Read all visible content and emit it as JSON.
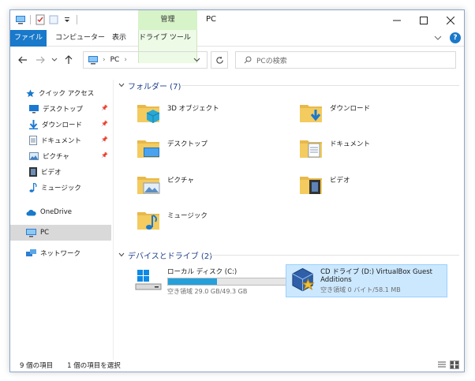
{
  "window": {
    "title": "PC",
    "context_tab": "管理"
  },
  "ribbon": {
    "tabs": [
      "ファイル",
      "コンピューター",
      "表示",
      "ドライブ ツール"
    ],
    "help": "?"
  },
  "nav": {
    "address_crumbs": [
      "PC"
    ],
    "search_placeholder": "PCの検索"
  },
  "sidebar": {
    "items": [
      {
        "label": "クイック アクセス",
        "icon": "star-icon"
      },
      {
        "label": "デスクトップ",
        "icon": "desktop-icon",
        "pinned": true
      },
      {
        "label": "ダウンロード",
        "icon": "download-icon",
        "pinned": true
      },
      {
        "label": "ドキュメント",
        "icon": "document-icon",
        "pinned": true
      },
      {
        "label": "ピクチャ",
        "icon": "picture-icon",
        "pinned": true
      },
      {
        "label": "ビデオ",
        "icon": "video-icon"
      },
      {
        "label": "ミュージック",
        "icon": "music-icon"
      },
      {
        "label": "OneDrive",
        "icon": "cloud-icon"
      },
      {
        "label": "PC",
        "icon": "pc-icon",
        "selected": true
      },
      {
        "label": "ネットワーク",
        "icon": "network-icon"
      }
    ]
  },
  "folders_group": {
    "title": "フォルダー (7)",
    "items": [
      {
        "label": "3D オブジェクト",
        "icon": "3d-objects-folder-icon"
      },
      {
        "label": "ダウンロード",
        "icon": "downloads-folder-icon"
      },
      {
        "label": "デスクトップ",
        "icon": "desktop-folder-icon"
      },
      {
        "label": "ドキュメント",
        "icon": "documents-folder-icon"
      },
      {
        "label": "ピクチャ",
        "icon": "pictures-folder-icon"
      },
      {
        "label": "ビデオ",
        "icon": "videos-folder-icon"
      },
      {
        "label": "ミュージック",
        "icon": "music-folder-icon"
      }
    ]
  },
  "drives_group": {
    "title": "デバイスとドライブ (2)",
    "items": [
      {
        "name": "ローカル ディスク (C:)",
        "free": "空き領域 29.0 GB/49.3 GB",
        "used_fraction": 0.41,
        "icon": "hard-disk-icon"
      },
      {
        "name": "CD ドライブ (D:) VirtualBox Guest Additions",
        "free": "空き領域 0 バイト/58.1 MB",
        "icon": "virtualbox-cd-icon",
        "selected": true
      }
    ]
  },
  "status": {
    "count": "9 個の項目",
    "selection": "1 個の項目を選択"
  },
  "colors": {
    "accent": "#1979ca",
    "group_header": "#1e3f8a",
    "selection": "#cce8ff",
    "context_tab": "#d7f3c8",
    "folder": "#f3cb5f",
    "drive_bar": "#26a0da"
  }
}
